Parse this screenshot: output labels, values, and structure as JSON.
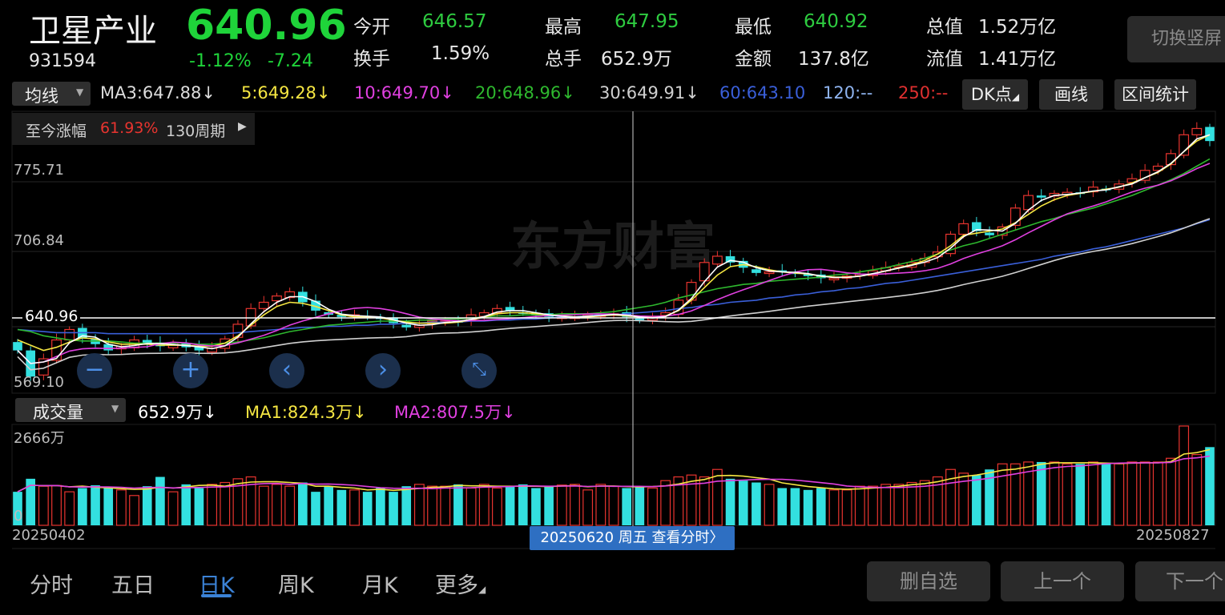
{
  "header": {
    "name": "卫星产业",
    "code": "931594",
    "price": "640.96",
    "change_pct": "-1.12%",
    "change_abs": "-7.24",
    "stats": [
      {
        "label": "今开",
        "value": "646.57",
        "color": "#2ecc40"
      },
      {
        "label": "最高",
        "value": "647.95",
        "color": "#2ecc40"
      },
      {
        "label": "最低",
        "value": "640.92",
        "color": "#2ecc40"
      },
      {
        "label": "总值",
        "value": "1.52万亿",
        "color": "#e8e8e8"
      },
      {
        "label": "换手",
        "value": "1.59%",
        "color": "#e8e8e8"
      },
      {
        "label": "总手",
        "value": "652.9万",
        "color": "#e8e8e8"
      },
      {
        "label": "金额",
        "value": "137.8亿",
        "color": "#e8e8e8"
      },
      {
        "label": "流值",
        "value": "1.41万亿",
        "color": "#e8e8e8"
      }
    ],
    "switch_button": "切换竖屏"
  },
  "ma_bar": {
    "selector": "均线",
    "items": [
      {
        "text": "MA3:647.88↓",
        "color": "#ffffff"
      },
      {
        "text": "5:649.28↓",
        "color": "#f5e642"
      },
      {
        "text": "10:649.70↓",
        "color": "#e040e0"
      },
      {
        "text": "20:648.96↓",
        "color": "#2eb82e"
      },
      {
        "text": "30:649.91↓",
        "color": "#d0d0d0"
      },
      {
        "text": "60:643.10",
        "color": "#3a5fd9"
      },
      {
        "text": "120:--",
        "color": "#8fb4f0"
      },
      {
        "text": "250:--",
        "color": "#e03030"
      }
    ],
    "dk_button": "DK点",
    "draw_button": "画线",
    "range_button": "区间统计"
  },
  "range_stat": {
    "label": "至今涨幅",
    "pct": "61.93%",
    "periods": "130周期"
  },
  "price_axis": {
    "top": "775.71",
    "mid": "706.84",
    "current": "640.96",
    "bottom": "569.10"
  },
  "watermark": "东方财富",
  "volume_bar": {
    "selector": "成交量",
    "vol": "652.9万↓",
    "ma1": "MA1:824.3万↓",
    "ma2": "MA2:807.5万↓",
    "axis_top": "2666万",
    "axis_bottom": "0"
  },
  "dates": {
    "start": "20250402",
    "end": "20250827",
    "cursor": "20250620 周五 查看分时"
  },
  "bottom_tabs": [
    "分时",
    "五日",
    "日K",
    "周K",
    "月K",
    "更多"
  ],
  "active_tab": "日K",
  "bottom_buttons": [
    "删自选",
    "上一个",
    "下一个"
  ],
  "colors": {
    "up": "#e8342f",
    "down": "#33e0e0",
    "ma3": "#ffffff",
    "ma5": "#f5e642",
    "ma10": "#e040e0",
    "ma20": "#2eb82e",
    "ma30": "#d0d0d0",
    "ma60": "#3a5fd9",
    "accent": "#3b82d6"
  },
  "chart_data": {
    "type": "candlestick",
    "ylim": [
      569.1,
      820
    ],
    "close_series": [
      600,
      575,
      592,
      610,
      620,
      612,
      606,
      600,
      604,
      610,
      606,
      604,
      607,
      603,
      600,
      602,
      611,
      625,
      640,
      646,
      652,
      656,
      646,
      638,
      634,
      632,
      634,
      632,
      630,
      626,
      622,
      624,
      628,
      628,
      627,
      634,
      636,
      640,
      638,
      636,
      634,
      632,
      632,
      632,
      634,
      634,
      635,
      632,
      629,
      632,
      636,
      648,
      665,
      684,
      690,
      684,
      679,
      674,
      675,
      676,
      673,
      671,
      669,
      669,
      671,
      673,
      676,
      679,
      681,
      684,
      688,
      694,
      711,
      721,
      714,
      710,
      718,
      736,
      748,
      746,
      750,
      751,
      750,
      756,
      754,
      759,
      764,
      772,
      776,
      788,
      806,
      812,
      800
    ],
    "volume_wan": [
      900,
      1250,
      1050,
      1070,
      900,
      1000,
      1075,
      1000,
      950,
      800,
      1050,
      1300,
      900,
      1100,
      1000,
      1100,
      1150,
      1250,
      1300,
      1050,
      1100,
      1050,
      1150,
      900,
      1050,
      950,
      950,
      900,
      1000,
      900,
      1050,
      1100,
      1050,
      1050,
      1100,
      1000,
      1100,
      1000,
      1050,
      1100,
      1000,
      1050,
      1080,
      1100,
      950,
      1100,
      1050,
      1000,
      1050,
      1000,
      1200,
      1300,
      1350,
      1300,
      1500,
      1250,
      1200,
      1150,
      1100,
      1000,
      1000,
      950,
      1000,
      950,
      950,
      1050,
      1050,
      1100,
      1100,
      1150,
      1200,
      1300,
      1500,
      1400,
      1350,
      1500,
      1650,
      1650,
      1700,
      1700,
      1700,
      1650,
      1650,
      1700,
      1650,
      1650,
      1700,
      1700,
      1700,
      1800,
      2666,
      1900,
      2100
    ],
    "ma_lines": {
      "MA5": [
        610,
        605,
        600,
        603,
        608,
        612,
        611,
        608,
        606,
        606,
        606,
        605,
        605,
        605,
        604,
        604,
        607,
        614,
        624,
        634,
        642,
        646,
        645,
        642,
        638,
        634,
        632,
        632,
        631,
        629,
        627,
        626,
        626,
        626,
        627,
        629,
        632,
        635,
        636,
        636,
        635,
        634,
        633,
        632,
        632,
        633,
        634,
        633,
        632,
        632,
        633,
        638,
        648,
        660,
        672,
        680,
        682,
        680,
        677,
        675,
        674,
        673,
        671,
        670,
        670,
        671,
        673,
        676,
        679,
        682,
        686,
        692,
        700,
        710,
        712,
        714,
        716,
        722,
        730,
        738,
        744,
        748,
        750,
        752,
        754,
        756,
        760,
        765,
        770,
        778,
        790,
        800,
        806
      ],
      "MA20": [
        620,
        618,
        614,
        612,
        610,
        609,
        609,
        609,
        608,
        607,
        607,
        607,
        607,
        607,
        606,
        606,
        607,
        608,
        610,
        612,
        615,
        618,
        620,
        622,
        624,
        625,
        626,
        627,
        628,
        628,
        628,
        629,
        629,
        630,
        630,
        631,
        632,
        633,
        633,
        634,
        634,
        634,
        635,
        635,
        635,
        636,
        637,
        639,
        641,
        643,
        646,
        650,
        653,
        656,
        659,
        661,
        663,
        664,
        666,
        667,
        668,
        669,
        670,
        672,
        673,
        675,
        677,
        679,
        682,
        685,
        688,
        692,
        696,
        700,
        703,
        707,
        711,
        715,
        719,
        723,
        726,
        730,
        733,
        736,
        740,
        744,
        748,
        753,
        758,
        763,
        769,
        776,
        783
      ],
      "MA60": [
        620,
        619,
        618,
        617,
        617,
        617,
        617,
        616,
        616,
        616,
        616,
        616,
        616,
        616,
        616,
        616,
        616,
        617,
        618,
        619,
        620,
        621,
        622,
        622,
        623,
        623,
        624,
        624,
        625,
        625,
        626,
        626,
        627,
        627,
        627,
        628,
        628,
        629,
        629,
        630,
        630,
        631,
        632,
        632,
        633,
        634,
        634,
        635,
        636,
        637,
        638,
        640,
        641,
        643,
        644,
        646,
        647,
        648,
        650,
        651,
        653,
        654,
        656,
        657,
        659,
        660,
        662,
        664,
        665,
        667,
        669,
        671,
        673,
        675,
        677,
        679,
        681,
        683,
        685,
        687,
        690,
        692,
        694,
        697,
        699,
        702,
        705,
        708,
        711,
        714,
        717,
        721,
        725
      ]
    }
  }
}
